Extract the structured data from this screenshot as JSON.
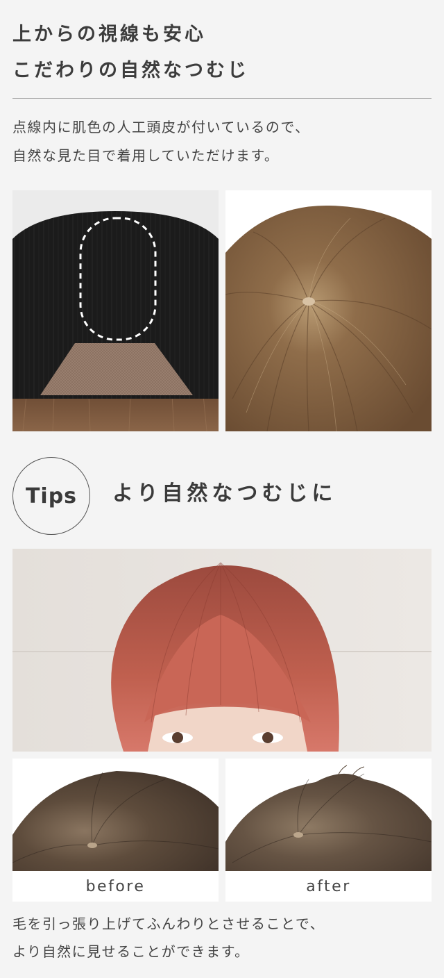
{
  "section1": {
    "heading_line1": "上からの視線も安心",
    "heading_line2": "こだわりの自然なつむじ",
    "description_line1": "点線内に肌色の人工頭皮が付いているので、",
    "description_line2": "自然な見た目で着用していただけます。"
  },
  "tips": {
    "badge": "Tips",
    "heading": "より自然なつむじに"
  },
  "comparison": {
    "before_label": "before",
    "after_label": "after"
  },
  "section2": {
    "description_line1": "毛を引っ張り上げてふんわりとさせることで、",
    "description_line2": "より自然に見せることができます。"
  },
  "colors": {
    "background": "#f4f4f4",
    "text": "#3a3a3a",
    "divider": "#9a9a9a",
    "cap_black": "#1c1c1c",
    "hair_brown": "#7a5a3a",
    "hair_pink": "#b5584a"
  }
}
